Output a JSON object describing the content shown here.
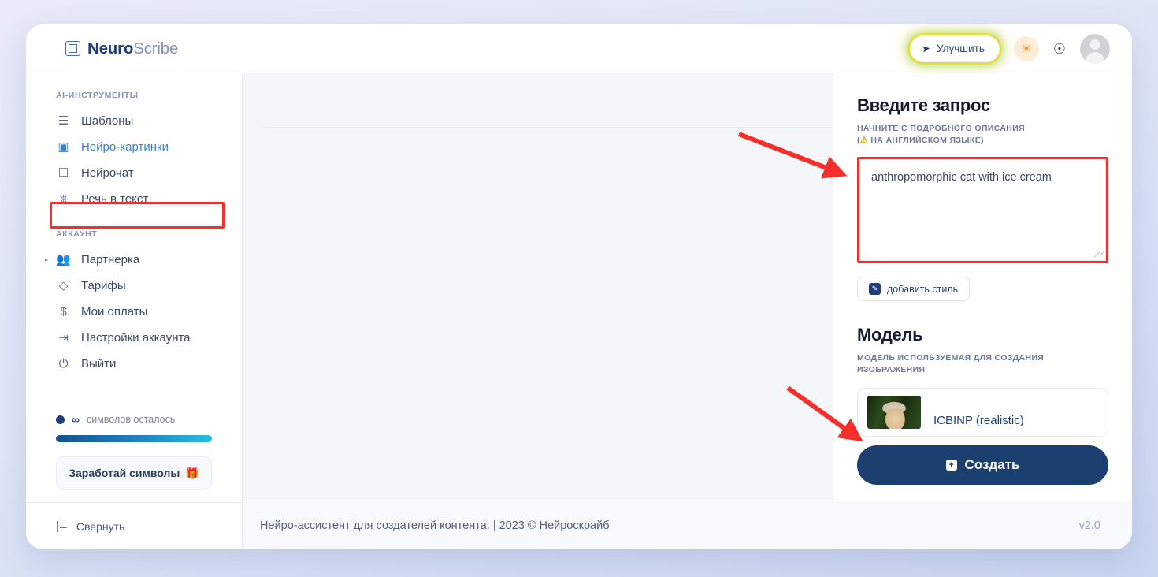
{
  "brand": {
    "name_bold": "Neuro",
    "name_light": "Scribe",
    "logo_icon": "nested-square-logo-icon"
  },
  "topbar": {
    "improve_label": "Улучшить",
    "improve_icon": "rocket-icon",
    "theme_icon": "sun-icon",
    "bell_icon": "bell-icon",
    "avatar_icon": "user-avatar-icon"
  },
  "sidebar": {
    "group1_title": "AI-ИНСТРУМЕНТЫ",
    "group1_items": [
      {
        "label": "Шаблоны",
        "icon": "layers-icon",
        "active": false
      },
      {
        "label": "Нейро-картинки",
        "icon": "image-icon",
        "active": true
      },
      {
        "label": "Нейрочат",
        "icon": "chat-bubble-icon",
        "active": false
      },
      {
        "label": "Речь в текст",
        "icon": "headphones-icon",
        "active": false
      }
    ],
    "group2_title": "АККАУНТ",
    "group2_items": [
      {
        "label": "Партнерка",
        "icon": "users-icon",
        "active": false,
        "caret": "▸"
      },
      {
        "label": "Тарифы",
        "icon": "tag-icon",
        "active": false,
        "caret": ""
      },
      {
        "label": "Мои оплаты",
        "icon": "dollar-icon",
        "active": false,
        "caret": ""
      },
      {
        "label": "Настройки аккаунта",
        "icon": "logout-bracket-icon",
        "active": false,
        "caret": ""
      },
      {
        "label": "Выйти",
        "icon": "power-icon",
        "active": false,
        "caret": ""
      }
    ],
    "quota_symbol": "∞",
    "quota_label": "символов осталось",
    "earn_label": "Заработай символы",
    "earn_icon": "gift-icon",
    "collapse_label": "Свернуть",
    "collapse_icon": "collapse-left-icon"
  },
  "right_panel": {
    "prompt_heading": "Введите запрос",
    "prompt_sub_line1": "НАЧНИТЕ С ПОДРОБНОГО ОПИСАНИЯ",
    "prompt_sub_line2_pre": "(",
    "prompt_sub_line2": "НА АНГЛИЙСКОМ ЯЗЫКЕ)",
    "warning_icon": "warning-triangle-icon",
    "prompt_value": "anthropomorphic cat with ice cream",
    "prompt_placeholder": "",
    "style_button_label": "добавить стиль",
    "style_button_icon": "pencil-square-icon",
    "model_heading": "Модель",
    "model_sub": "МОДЕЛЬ ИСПОЛЬЗУЕМАЯ ДЛЯ СОЗДАНИЯ ИЗОБРАЖЕНИЯ",
    "model_name": "ICBINP (realistic)",
    "model_thumb_icon": "model-preview-thumbnail",
    "create_label": "Создать",
    "create_icon": "plus-square-icon"
  },
  "footer": {
    "text": "Нейро-ассистент для создателей контента.  | 2023 © Нейроскрайб",
    "version": "v2.0"
  },
  "annotations": {
    "arrow_color": "#f5302c",
    "highlight_color": "#f5302c",
    "arrow1": "arrow-to-prompt-field",
    "arrow2": "arrow-to-create-button"
  }
}
